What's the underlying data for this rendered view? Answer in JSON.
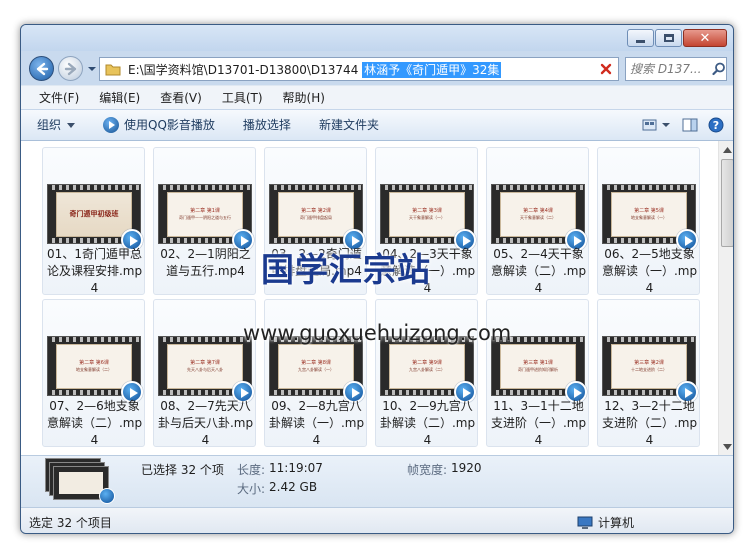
{
  "window": {
    "controls": {
      "minimize": "minimize",
      "maximize": "maximize",
      "close": "close"
    }
  },
  "address": {
    "path_prefix": "E:\\国学资料馆\\D13701-D13800\\D13744 ",
    "path_selected": "林涵予《奇门遁甲》32集"
  },
  "search": {
    "placeholder": "搜索 D137..."
  },
  "menu": [
    "文件(F)",
    "编辑(E)",
    "查看(V)",
    "工具(T)",
    "帮助(H)"
  ],
  "toolbar": {
    "organize": "组织",
    "play_qq": "使用QQ影音播放",
    "play_selection": "播放选择",
    "new_folder": "新建文件夹"
  },
  "files": [
    {
      "label": "01、1奇门遁甲总论及课程安排.mp4",
      "thumb_title": "奇门遁甲初级班",
      "thumb_sub": ""
    },
    {
      "label": "02、2—1阴阳之道与五行.mp4",
      "thumb_title": "第二章 第1课",
      "thumb_sub": "奇门遁甲——阴阳之道与五行"
    },
    {
      "label": "03、2—2奇门遁甲排盘起局.mp4",
      "thumb_title": "第二章 第2课",
      "thumb_sub": "奇门遁甲排盘起局"
    },
    {
      "label": "04、2—3天干象意解读（一）.mp4",
      "thumb_title": "第二章 第3课",
      "thumb_sub": "天干象意解读（一）"
    },
    {
      "label": "05、2—4天干象意解读（二）.mp4",
      "thumb_title": "第二章 第4课",
      "thumb_sub": "天干象意解读（二）"
    },
    {
      "label": "06、2—5地支象意解读（一）.mp4",
      "thumb_title": "第二章 第5课",
      "thumb_sub": "地支象意解读（一）"
    },
    {
      "label": "07、2—6地支象意解读（二）.mp4",
      "thumb_title": "第二章 第6课",
      "thumb_sub": "地支象意解读（二）"
    },
    {
      "label": "08、2—7先天八卦与后天八卦.mp4",
      "thumb_title": "第二章 第7课",
      "thumb_sub": "先天八卦与后天八卦"
    },
    {
      "label": "09、2—8九宫八卦解读（一）.mp4",
      "thumb_title": "第二章 第8课",
      "thumb_sub": "九宫八卦解读（一）"
    },
    {
      "label": "10、2—9九宫八卦解读（二）.mp4",
      "thumb_title": "第二章 第9课",
      "thumb_sub": "九宫八卦解读（二）"
    },
    {
      "label": "11、3—1十二地支进阶（一）.mp4",
      "thumb_title": "第三章 第1课",
      "thumb_sub": "奇门遁甲进阶知识解析"
    },
    {
      "label": "12、3—2十二地支进阶（二）.mp4",
      "thumb_title": "第三章 第2课",
      "thumb_sub": "十二地支进阶（二）"
    }
  ],
  "watermark": {
    "cn": "国学汇宗站",
    "url": "www.guoxuehuizong.com"
  },
  "details": {
    "selected": "已选择 32 个项",
    "length_key": "长度:",
    "length_val": "11:19:07",
    "size_key": "大小:",
    "size_val": "2.42 GB",
    "frame_width_key": "帧宽度:",
    "frame_width_val": "1920"
  },
  "status": {
    "left": "选定 32 个项目",
    "right": "计算机"
  }
}
